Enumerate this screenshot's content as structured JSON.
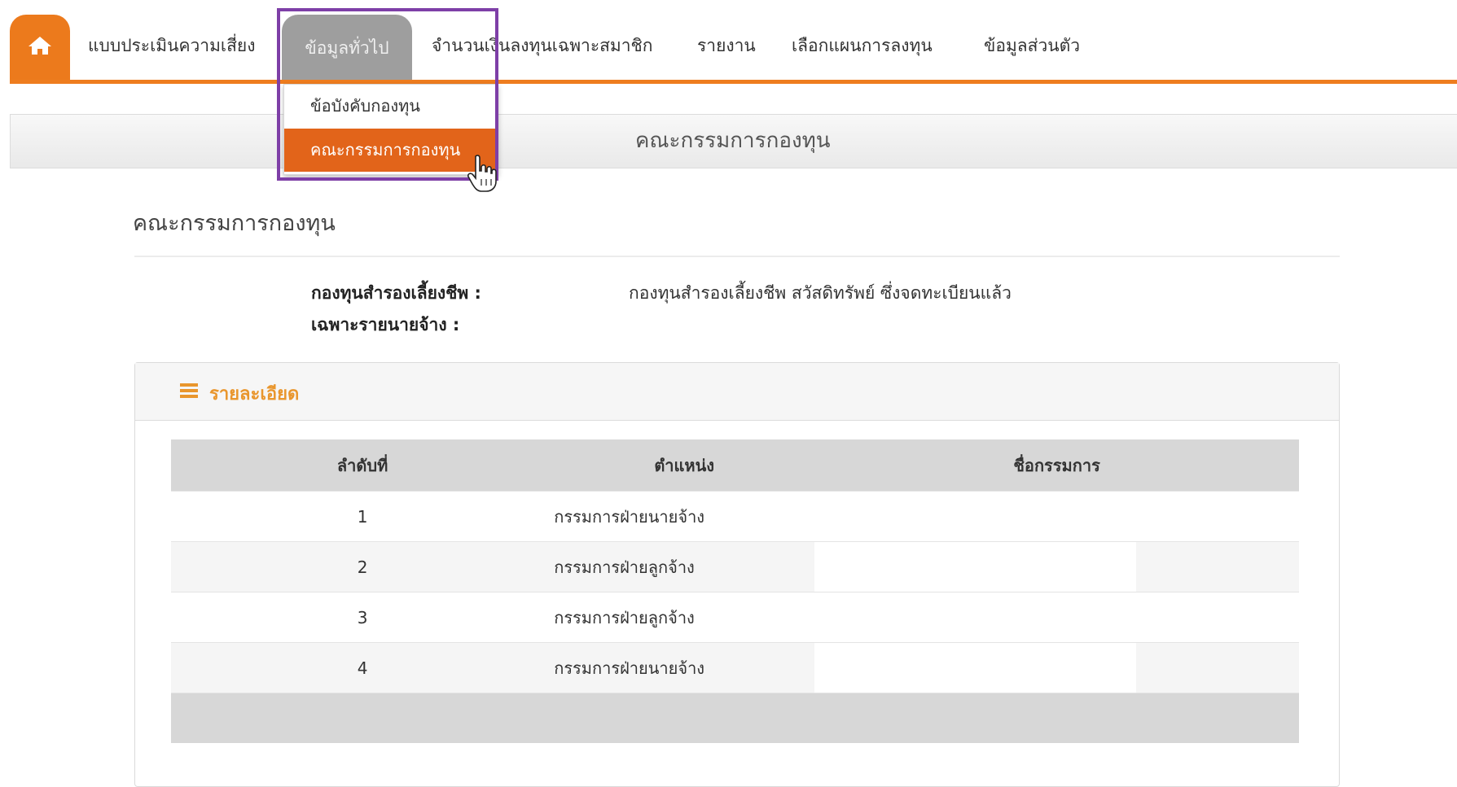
{
  "nav": {
    "home_icon": "home-icon",
    "items": [
      "แบบประเมินความเสี่ยง",
      "ข้อมูลทั่วไป",
      "จำนวนเงินลงทุนเฉพาะสมาชิก",
      "รายงาน",
      "เลือกแผนการลงทุน",
      "ข้อมูลส่วนตัว"
    ],
    "active_index": 1
  },
  "dropdown": {
    "items": [
      "ข้อบังคับกองทุน",
      "คณะกรรมการกองทุน"
    ],
    "highlighted_index": 1
  },
  "header": {
    "title": "คณะกรรมการกองทุน"
  },
  "section": {
    "title": "คณะกรรมการกองทุน",
    "fund_label": "กองทุนสำรองเลี้ยงชีพ :",
    "employer_label": "เฉพาะรายนายจ้าง :",
    "fund_value": "กองทุนสำรองเลี้ยงชีพ สวัสดิทรัพย์ ซึ่งจดทะเบียนแล้ว"
  },
  "panel": {
    "title": "รายละเอียด",
    "columns": [
      "ลำดับที่",
      "ตำแหน่ง",
      "ชื่อกรรมการ"
    ],
    "rows": [
      [
        "1",
        "กรรมการฝ่ายนายจ้าง",
        ""
      ],
      [
        "2",
        "กรรมการฝ่ายลูกจ้าง",
        ""
      ],
      [
        "3",
        "กรรมการฝ่ายลูกจ้าง",
        ""
      ],
      [
        "4",
        "กรรมการฝ่ายนายจ้าง",
        ""
      ]
    ]
  },
  "colors": {
    "accent": "#ec7a1c",
    "active_tab": "#9e9e9e",
    "highlight_border": "#7e3fa7",
    "panel_title": "#e9962d"
  }
}
